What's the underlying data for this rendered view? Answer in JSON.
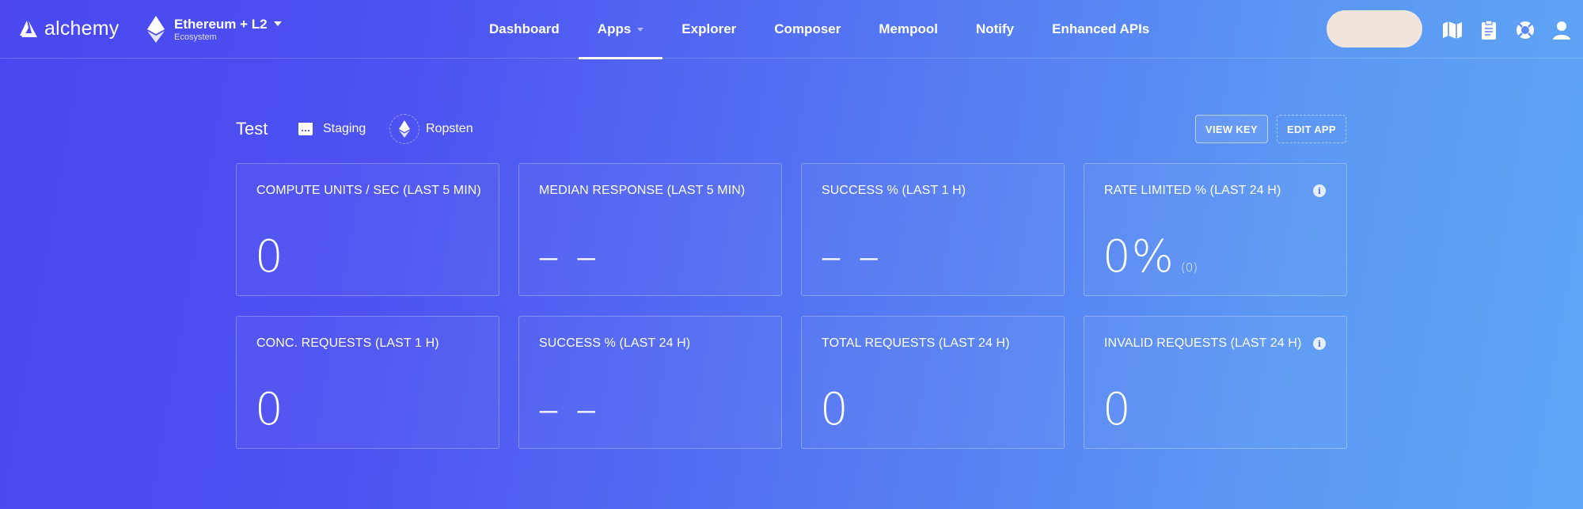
{
  "brand": {
    "name": "alchemy"
  },
  "network": {
    "name": "Ethereum + L2",
    "sub": "Ecosystem"
  },
  "nav": {
    "items": [
      {
        "label": "Dashboard"
      },
      {
        "label": "Apps"
      },
      {
        "label": "Explorer"
      },
      {
        "label": "Composer"
      },
      {
        "label": "Mempool"
      },
      {
        "label": "Notify"
      },
      {
        "label": "Enhanced APIs"
      }
    ],
    "active": "Apps"
  },
  "header_icons": [
    "map-icon",
    "clipboard-icon",
    "lifebuoy-icon",
    "user-icon"
  ],
  "app": {
    "name": "Test",
    "environment": "Staging",
    "network": "Ropsten",
    "view_key_label": "VIEW KEY",
    "edit_app_label": "EDIT APP"
  },
  "stats": [
    {
      "label": "COMPUTE UNITS / SEC (LAST 5 MIN)",
      "value": "0"
    },
    {
      "label": "MEDIAN RESPONSE (LAST 5 MIN)",
      "value": "– –"
    },
    {
      "label": "SUCCESS % (LAST 1 H)",
      "value": "– –"
    },
    {
      "label": "RATE LIMITED % (LAST 24 H)",
      "value": "0%",
      "extra": "(0)",
      "info": true
    },
    {
      "label": "CONC. REQUESTS (LAST 1 H)",
      "value": "0"
    },
    {
      "label": "SUCCESS % (LAST 24 H)",
      "value": "– –"
    },
    {
      "label": "TOTAL REQUESTS (LAST 24 H)",
      "value": "0"
    },
    {
      "label": "INVALID REQUESTS (LAST 24 H)",
      "value": "0",
      "info": true
    }
  ],
  "colors": {
    "bg_start": "#4a47f0",
    "bg_end": "#5ea7f6",
    "pill": "#efe5dc"
  }
}
